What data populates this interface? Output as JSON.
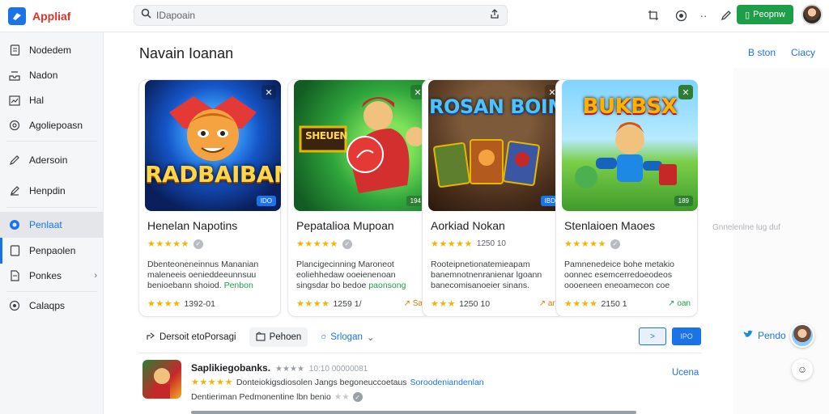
{
  "app": {
    "name": "Appliaf"
  },
  "search": {
    "value": "IDapoain",
    "placeholder": "IDapoain"
  },
  "header": {
    "primary_button": "Peopnw"
  },
  "sidebar": {
    "items": [
      {
        "label": "Nodedem",
        "icon": "document-icon"
      },
      {
        "label": "Nadon",
        "icon": "inbox-icon"
      },
      {
        "label": "Hal",
        "icon": "chart-icon"
      },
      {
        "label": "Agoliepoasn",
        "icon": "circle-icon"
      },
      {
        "label": "Adersoin",
        "icon": "pencil-icon"
      },
      {
        "label": "Henpdin",
        "icon": "edit-icon"
      },
      {
        "label": "Penlaat",
        "icon": "globe-icon"
      },
      {
        "label": "Penpaolen",
        "icon": "page-icon"
      },
      {
        "label": "Ponkes",
        "icon": "file-icon"
      },
      {
        "label": "Calaqps",
        "icon": "settings-icon"
      }
    ]
  },
  "main": {
    "title": "Navain Ioanan",
    "links": {
      "store": "B ston",
      "close": "Ciacy"
    },
    "cards": [
      {
        "thumb_title": "RADBAIBAN",
        "badge": "IDO",
        "title": "Henelan Napotins",
        "desc_1": "Dbenteoneneinnus Mananian",
        "desc_2": "maleneeis oenieddeeunnsuu",
        "desc_3": "benioebann shoiod.",
        "desc_link": "Penbon",
        "foot": "1392-01",
        "meta": ""
      },
      {
        "thumb_title": "SHEUEN",
        "badge": "194",
        "title": "Pepatalioa Mupoan",
        "desc_1": "Plancigecinning Maroneot",
        "desc_2": "eoliehhedaw ooeienenoan",
        "desc_3": "singsdar bo bedoe",
        "desc_link": "paonsong",
        "foot": "1259 1/",
        "meta": "↗ Sa"
      },
      {
        "thumb_title": "ROSAN BOIN",
        "badge": "IBD",
        "title": "Aorkiad Nokan",
        "desc_1": "Rooteipnetionatemieapam",
        "desc_2": "banemnotnenranienar lgoann",
        "desc_3": "banecomisanoeier sinans.",
        "desc_link": "",
        "foot": "1250 10",
        "meta": "↗ an"
      },
      {
        "thumb_title": "BUKBSX",
        "badge": "189",
        "title": "Stenlaioen Maoes",
        "desc_1": "Pamnenedeice bohe metakio",
        "desc_2": "oonnec esemcerredoeodeos",
        "desc_3": "oooeneen eneoamecon coe",
        "desc_link": "",
        "foot": "2150 1",
        "meta": "↗ oan"
      }
    ],
    "caption": "Gnnelenlne lug duf",
    "filters": {
      "chip_1": "Dersoit etoPorsagi",
      "chip_2": "Pehoen",
      "chip_3": "Srlogan"
    },
    "buttons": {
      "next": ">",
      "apply": "IPO"
    },
    "list_item": {
      "title": "Saplikiegobanks.",
      "title_sub": "10:10 00000081",
      "desc": "Donteiokigsdiosolen Jangs begoneuccoetaus",
      "desc_link": "Soroodeniandenlan",
      "meta": "Dentieriman Pedmonentine lbn benio",
      "action": "Ucena"
    }
  },
  "right": {
    "link": "Pendo"
  }
}
